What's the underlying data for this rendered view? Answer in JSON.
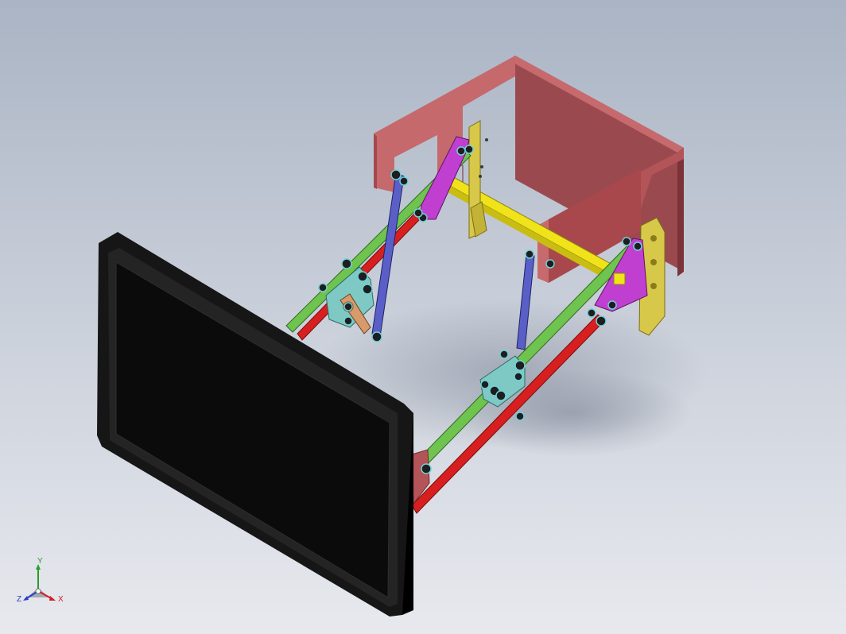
{
  "window": {
    "title": ""
  },
  "triad": {
    "y_label": "Y",
    "z_label": "Z",
    "x_label": "X",
    "colors": {
      "y": "#2e9b2e",
      "z": "#2a3fbf",
      "x": "#d02020"
    }
  },
  "model": {
    "part_colors": {
      "enclosure": "#b85c5c",
      "enclosure_dark": "#8f3f42",
      "green_link": "#6fc34f",
      "red_link": "#d81f1f",
      "blue_link": "#5a5fc8",
      "yellow_shaft": "#f0e31a",
      "magenta_plate": "#c13fd0",
      "teal_bracket": "#7fc9c4",
      "orange_lever": "#d79a6a",
      "olive_bracket": "#d8c84a",
      "monitor": "#111111",
      "bolt": "#1e1e1e"
    }
  }
}
